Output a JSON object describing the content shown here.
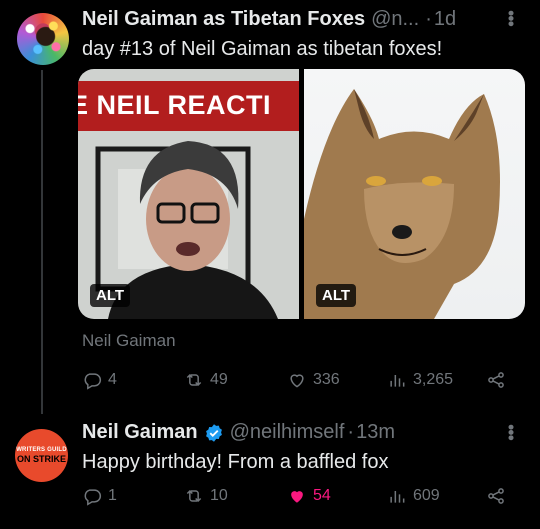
{
  "tweets": [
    {
      "author_name": "Neil Gaiman as Tibetan Foxes",
      "handle": "@n...",
      "time": "1d",
      "text": "day #13 of Neil Gaiman as tibetan foxes!",
      "media": {
        "left_banner": "E NEIL REACTI",
        "left_alt": "ALT",
        "right_alt": "ALT"
      },
      "caption": "Neil Gaiman",
      "actions": {
        "replies": "4",
        "retweets": "49",
        "likes": "336",
        "views": "3,265"
      }
    },
    {
      "author_name": "Neil Gaiman",
      "handle": "@neilhimself",
      "time": "13m",
      "text": "Happy birthday! From a baffled fox",
      "avatar_line1": "WRITERS GUILD",
      "avatar_line2": "ON STRIKE",
      "actions": {
        "replies": "1",
        "retweets": "10",
        "likes": "54",
        "views": "609"
      }
    }
  ],
  "colors": {
    "like_active": "#f91880",
    "verified": "#1d9bf0",
    "muted": "#71767b",
    "banner_red": "#b21e1e"
  },
  "icons": [
    "more-icon",
    "reply-icon",
    "retweet-icon",
    "like-icon",
    "views-icon",
    "share-icon",
    "verified-icon"
  ]
}
